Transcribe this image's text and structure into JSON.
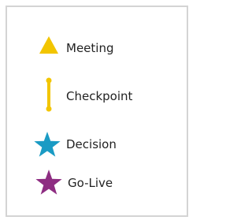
{
  "legend": {
    "items": [
      {
        "label": "Meeting",
        "icon": "triangle-icon",
        "color": "#f2c500"
      },
      {
        "label": "Checkpoint",
        "icon": "checkpoint-icon",
        "color": "#f2c500"
      },
      {
        "label": "Decision",
        "icon": "star-icon",
        "color": "#1a9bc4"
      },
      {
        "label": "Go-Live",
        "icon": "star-icon",
        "color": "#8e2d82"
      }
    ],
    "border_color": "#d4d4d4"
  }
}
